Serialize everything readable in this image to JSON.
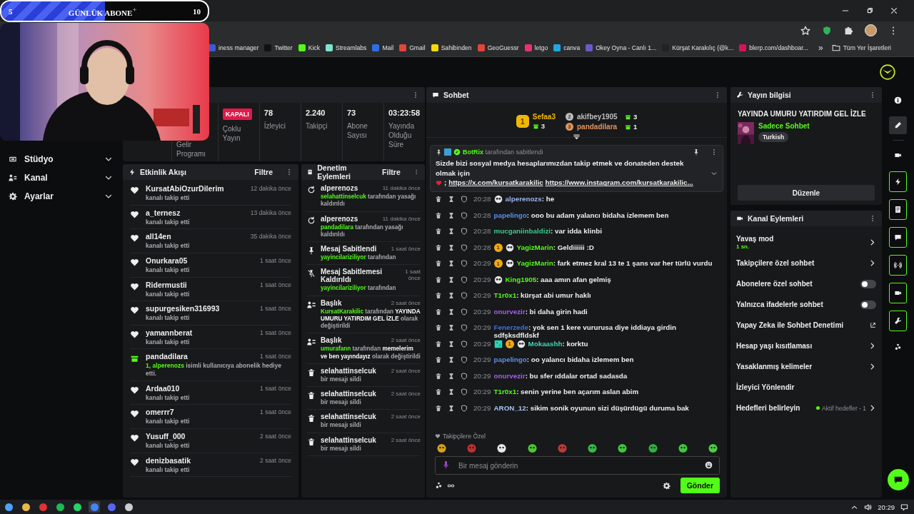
{
  "subgoal": {
    "current": "5",
    "title": "GÜNLÜK ABONE",
    "plus": "+",
    "target": "10",
    "level": 0.5
  },
  "bookmarks": [
    {
      "label": "iness manager"
    },
    {
      "label": "Twitter"
    },
    {
      "label": "Kick"
    },
    {
      "label": "Streamlabs"
    },
    {
      "label": "Mail"
    },
    {
      "label": "Gmail"
    },
    {
      "label": "Sahibinden"
    },
    {
      "label": "GeoGuessr"
    },
    {
      "label": "letgo"
    },
    {
      "label": "canva"
    },
    {
      "label": "Okey Oyna - Canlı 1..."
    },
    {
      "label": "Kürşat Karakılıç (@k..."
    },
    {
      "label": "blerp.com/dashboar..."
    }
  ],
  "bookmarks_more": "»",
  "all_bookmarks": "Tüm Yer İşaretleri",
  "sidebar": [
    {
      "label": "Stüdyo",
      "kind": "studio"
    },
    {
      "label": "Kanal",
      "kind": "channel"
    },
    {
      "label": "Ayarlar",
      "kind": "settings"
    }
  ],
  "stats": [
    {
      "kind": "label",
      "label": "Gelir Programı"
    },
    {
      "kind": "status",
      "value": "KAPALI",
      "label": "Çoklu Yayın"
    },
    {
      "kind": "number",
      "value": "78",
      "label": "İzleyici"
    },
    {
      "kind": "number",
      "value": "2.240",
      "label": "Takipçi"
    },
    {
      "kind": "number",
      "value": "73",
      "label": "Abone Sayısı"
    },
    {
      "kind": "number",
      "value": "03:23:58",
      "label": "Yayında Olduğu Süre"
    }
  ],
  "events": {
    "title": "Etkinlik Akışı",
    "filter": "Filtre",
    "items": [
      {
        "kind": "follow",
        "user": "KursatAbiOzurDilerim",
        "time": "12 dakika önce",
        "text": "kanalı takip etti"
      },
      {
        "kind": "follow",
        "user": "a_ternesz",
        "time": "13 dakika önce",
        "text": "kanalı takip etti"
      },
      {
        "kind": "follow",
        "user": "all14en",
        "time": "35 dakika önce",
        "text": "kanalı takip etti"
      },
      {
        "kind": "follow",
        "user": "Onurkara05",
        "time": "1 saat önce",
        "text": "kanalı takip etti"
      },
      {
        "kind": "follow",
        "user": "Ridermustii",
        "time": "1 saat önce",
        "text": "kanalı takip etti"
      },
      {
        "kind": "follow",
        "user": "supurgesiken316993",
        "time": "1 saat önce",
        "text": "kanalı takip etti"
      },
      {
        "kind": "follow",
        "user": "yamannberat",
        "time": "1 saat önce",
        "text": "kanalı takip etti"
      },
      {
        "kind": "gift",
        "user": "pandadilara",
        "time": "1 saat önce",
        "highlight": "1, alperenozs",
        "text": "isimli kullanıcıya abonelik hediye etti."
      },
      {
        "kind": "follow",
        "user": "Ardaa010",
        "time": "1 saat önce",
        "text": "kanalı takip etti"
      },
      {
        "kind": "follow",
        "user": "omerrr7",
        "time": "1 saat önce",
        "text": "kanalı takip etti"
      },
      {
        "kind": "follow",
        "user": "Yusuff_000",
        "time": "2 saat önce",
        "text": "kanalı takip etti"
      },
      {
        "kind": "follow",
        "user": "denizbasatik",
        "time": "2 saat önce",
        "text": "kanalı takip etti"
      }
    ]
  },
  "moderation": {
    "title": "Denetim Eylemleri",
    "filter": "Filtre",
    "items": [
      {
        "kind": "unban",
        "title": "alperenozs",
        "time": "11 dakika önce",
        "actor": "selahattinselcuk",
        "text": "tarafından yasağı kaldırıldı"
      },
      {
        "kind": "unban",
        "title": "alperenozs",
        "time": "11 dakika önce",
        "actor": "pandadilara",
        "text": "tarafından yasağı kaldırıldı"
      },
      {
        "kind": "pin",
        "title": "Mesaj Sabitlendi",
        "time": "1 saat önce",
        "actor": "yayincilariziliyor",
        "text": "tarafından"
      },
      {
        "kind": "unpin",
        "title": "Mesaj Sabitlemesi Kaldırıldı",
        "time": "1 saat önce",
        "actor": "yayincilariziliyor",
        "text": "tarafından"
      },
      {
        "kind": "title",
        "title": "Başlık",
        "time": "2 saat önce",
        "actor": "KursatKarakilic",
        "text": "tarafından **YAYINDA UMURU YATIRDIM GEL İZLE** olarak değiştirildi"
      },
      {
        "kind": "title",
        "title": "Başlık",
        "time": "2 saat önce",
        "actor": "umurafann",
        "text": "tarafından **memelerim ve ben yayındayız** olarak değiştirildi"
      },
      {
        "kind": "delete",
        "title": "selahattinselcuk",
        "time": "2 saat önce",
        "text": "bir mesajı sildi"
      },
      {
        "kind": "delete",
        "title": "selahattinselcuk",
        "time": "2 saat önce",
        "text": "bir mesajı sildi"
      },
      {
        "kind": "delete",
        "title": "selahattinselcuk",
        "time": "2 saat önce",
        "text": "bir mesajı sildi"
      },
      {
        "kind": "delete",
        "title": "selahattinselcuk",
        "time": "2 saat önce",
        "text": "bir mesajı sildi"
      }
    ]
  },
  "chat": {
    "title": "Sohbet",
    "leaders": [
      {
        "rank": "1",
        "user": "Sefaa3",
        "count": "3",
        "color": "#f2b705"
      },
      {
        "rank": "2",
        "user": "akifbey1905",
        "count": "3",
        "color": "#bdbdbd"
      },
      {
        "rank": "3",
        "user": "pandadilara",
        "count": "1",
        "color": "#e0935c"
      }
    ],
    "pinned": {
      "by": "BotRix",
      "by_suffix": "tarafından sabitlendi",
      "text": "Sizde bizi sosyal medya hesaplarımızdan takip etmek ve donateden destek olmak için",
      "after_heart": ";",
      "links": [
        "https://x.com/kursatkarakilic",
        "https://www.instagram.com/kursatkarakilic..."
      ]
    },
    "messages": [
      {
        "time": "20:28",
        "badges": [
          {
            "kind": "emote"
          }
        ],
        "user": "alperenozs",
        "color": "#9db4ee",
        "text": ": he"
      },
      {
        "time": "20:28",
        "user": "papelingo",
        "color": "#5b8ee6",
        "text": ": ooo bu adam yalancı bidaha izlemem ben"
      },
      {
        "time": "20:28",
        "user": "mucganiinbaldizi",
        "color": "#3cc98c",
        "text": ": var idda klinbi"
      },
      {
        "time": "20:28",
        "badges": [
          {
            "kind": "sub",
            "label": "1"
          },
          {
            "kind": "emote"
          }
        ],
        "user": "YagizMarin",
        "color": "#53fc18",
        "text": ": Geldiiiiii :D"
      },
      {
        "time": "20:29",
        "badges": [
          {
            "kind": "sub",
            "label": "1"
          },
          {
            "kind": "emote"
          }
        ],
        "user": "YagizMarin",
        "color": "#53fc18",
        "text": ": fark etmez kral 13 te 1 şans var her türlü vurdu"
      },
      {
        "time": "20:29",
        "badges": [
          {
            "kind": "emote"
          }
        ],
        "user": "King1905",
        "color": "#53fc18",
        "text": ": aaa amın afan gelmiş"
      },
      {
        "time": "20:29",
        "user": "T1r0x1",
        "color": "#53fc18",
        "text": ": kürşat abi umur haklı"
      },
      {
        "time": "20:29",
        "user": "onurvezir",
        "color": "#a65cf0",
        "text": ": bi daha girin hadi"
      },
      {
        "time": "20:29",
        "user": "Fenerzede",
        "color": "#3f6fd8",
        "text": ": yok sen 1 kere vururusa diye iddiaya girdin sdfşksdfldskf"
      },
      {
        "time": "20:29",
        "badges": [
          {
            "kind": "pixel"
          },
          {
            "kind": "sub",
            "label": "1"
          },
          {
            "kind": "emote"
          }
        ],
        "user": "Mokaashh",
        "color": "#3fd7b5",
        "text": ": korktu"
      },
      {
        "time": "20:29",
        "user": "papelingo",
        "color": "#5b8ee6",
        "text": ": oo yalancı bidaha izlemem ben"
      },
      {
        "time": "20:29",
        "user": "onurvezir",
        "color": "#a65cf0",
        "text": ": bu sfer ıddalar ortad sadasda"
      },
      {
        "time": "20:29",
        "user": "T1r0x1",
        "color": "#53fc18",
        "text": ": senin yerine ben açarım aslan abim"
      },
      {
        "time": "20:29",
        "user": "ARON_12",
        "color": "#a9c6f2",
        "text": ": sikim sonik oyunun sizi düşürdügü duruma bak"
      }
    ],
    "mode": "Takipçilere Özel",
    "placeholder": "Bir mesaj gönderin",
    "send": "Gönder"
  },
  "stream_info": {
    "title": "Yayın bilgisi",
    "stream_title": "YAYINDA UMURU YATIRDIM GEL İZLE",
    "category": "Sadece Sohbet",
    "tag": "Turkish",
    "edit": "Düzenle"
  },
  "channel_actions": {
    "title": "Kanal Eylemleri",
    "items": [
      {
        "kind": "arrow",
        "label": "Yavaş mod",
        "sub": "1 sn."
      },
      {
        "kind": "arrow",
        "label": "Takipçilere özel sohbet"
      },
      {
        "kind": "toggle",
        "label": "Abonelere özel sohbet",
        "on": false
      },
      {
        "kind": "toggle",
        "label": "Yalnızca ifadelerle sohbet",
        "on": false
      },
      {
        "kind": "external",
        "label": "Yapay Zeka ile Sohbet Denetimi"
      },
      {
        "kind": "arrow",
        "label": "Hesap yaşı kısıtlaması"
      },
      {
        "kind": "arrow",
        "label": "Yasaklanmış kelimeler"
      },
      {
        "kind": "plain",
        "label": "İzleyici Yönlendir"
      },
      {
        "kind": "goal",
        "label": "Hedefleri belirleyin",
        "value": "Aktif hedefler - 1"
      }
    ]
  },
  "rail": [
    {
      "kind": "info",
      "selected": false,
      "active": false
    },
    {
      "kind": "pencil",
      "selected": true,
      "active": false
    },
    {
      "kind": "camera",
      "selected": false,
      "active": false
    },
    {
      "kind": "bolt",
      "selected": false,
      "active": true
    },
    {
      "kind": "note",
      "selected": false,
      "active": true
    },
    {
      "kind": "chat",
      "selected": false,
      "active": true
    },
    {
      "kind": "broadcast",
      "selected": false,
      "active": true
    },
    {
      "kind": "camera",
      "selected": false,
      "active": true
    },
    {
      "kind": "wrench",
      "selected": false,
      "active": true
    },
    {
      "kind": "cluster",
      "selected": false,
      "active": false
    }
  ],
  "taskbar": {
    "time": "20:29"
  }
}
